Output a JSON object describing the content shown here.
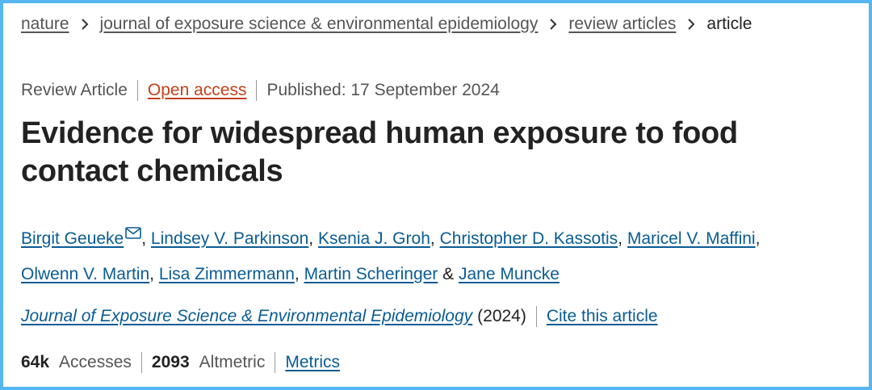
{
  "breadcrumb": {
    "items": [
      "nature",
      "journal of exposure science & environmental epidemiology",
      "review articles"
    ],
    "current": "article"
  },
  "meta": {
    "article_type": "Review Article",
    "open_access": "Open access",
    "published": "Published: 17 September 2024"
  },
  "title": "Evidence for widespread human exposure to food contact chemicals",
  "authors": [
    "Birgit Geueke",
    "Lindsey V. Parkinson",
    "Ksenia J. Groh",
    "Christopher D. Kassotis",
    "Maricel V. Maffini",
    "Olwenn V. Martin",
    "Lisa Zimmermann",
    "Martin Scheringer",
    "Jane Muncke"
  ],
  "author_separators": {
    "comma": ",",
    "ampersand": "&"
  },
  "journal": {
    "name": "Journal of Exposure Science & Environmental Epidemiology",
    "year": "(2024)",
    "cite": "Cite this article"
  },
  "metrics": {
    "accesses_value": "64k",
    "accesses_label": "Accesses",
    "altmetric_value": "2093",
    "altmetric_label": "Altmetric",
    "metrics_link": "Metrics"
  },
  "colors": {
    "frame_border": "#55b6f0",
    "link": "#0a5c94",
    "open_access": "#c4411b",
    "text": "#222222",
    "muted": "#555555"
  },
  "icons": {
    "chevron": "chevron-right-icon",
    "mail": "mail-icon"
  }
}
